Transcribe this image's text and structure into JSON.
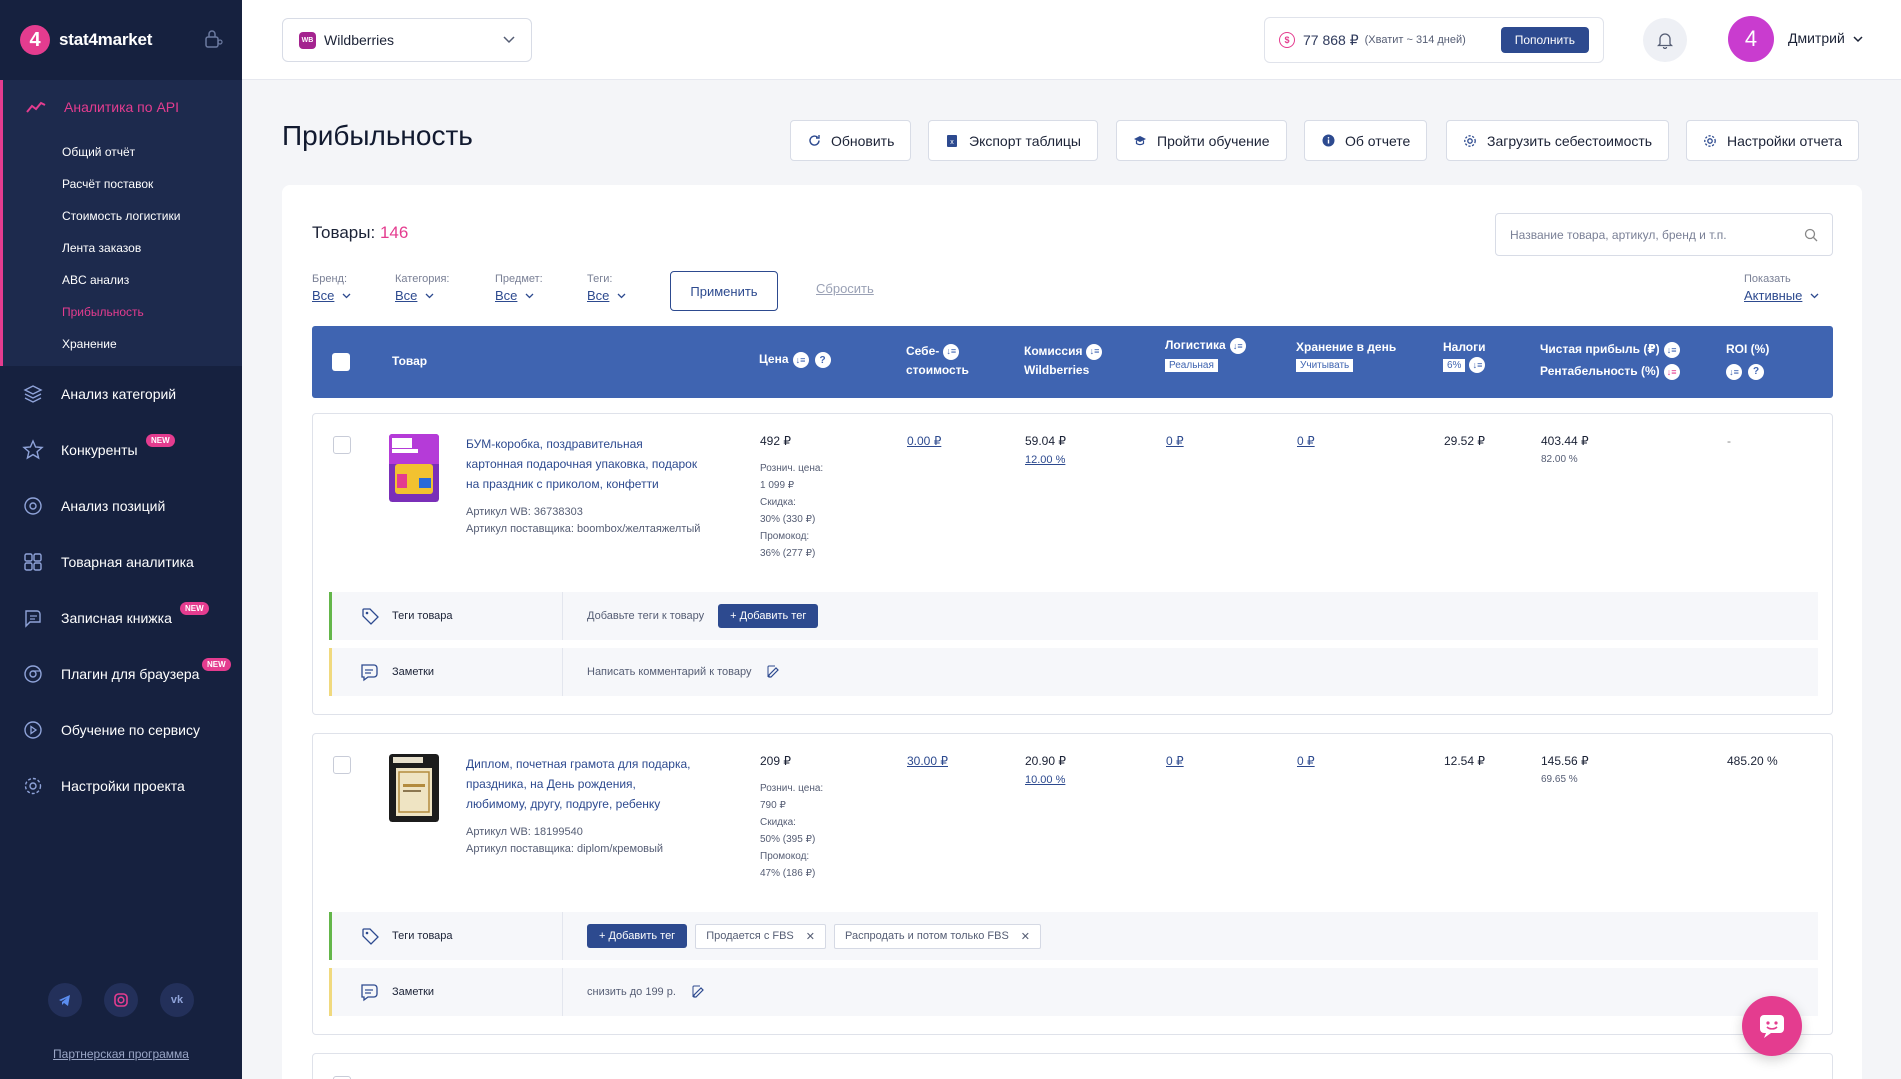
{
  "app": {
    "logo_glyph": "4",
    "logo_text": "stat4market"
  },
  "sidebar": {
    "section_title": "Аналитика по API",
    "sub_items": [
      {
        "label": "Общий отчёт",
        "active": false
      },
      {
        "label": "Расчёт поставок",
        "active": false
      },
      {
        "label": "Стоимость логистики",
        "active": false
      },
      {
        "label": "Лента заказов",
        "active": false
      },
      {
        "label": "ABC анализ",
        "active": false
      },
      {
        "label": "Прибыльность",
        "active": true
      },
      {
        "label": "Хранение",
        "active": false
      }
    ],
    "nav_items": [
      {
        "label": "Анализ категорий",
        "icon": "layers-icon",
        "badge": ""
      },
      {
        "label": "Конкуренты",
        "icon": "star-icon",
        "badge": "NEW"
      },
      {
        "label": "Анализ позиций",
        "icon": "target-icon",
        "badge": ""
      },
      {
        "label": "Товарная аналитика",
        "icon": "grid-icon",
        "badge": ""
      },
      {
        "label": "Записная книжка",
        "icon": "notebook-icon",
        "badge": "NEW"
      },
      {
        "label": "Плагин для браузера",
        "icon": "chrome-icon",
        "badge": "NEW"
      },
      {
        "label": "Обучение по сервису",
        "icon": "play-icon",
        "badge": ""
      },
      {
        "label": "Настройки проекта",
        "icon": "gear-icon",
        "badge": ""
      }
    ],
    "socials": [
      "telegram-icon",
      "instagram-icon",
      "vk-icon"
    ],
    "partner_link": "Партнерская программа"
  },
  "topbar": {
    "marketplace": {
      "badge": "WB",
      "label": "Wildberries"
    },
    "balance": {
      "amount": "77 868 ₽",
      "note": "(Хватит ~ 314 дней)",
      "topup_label": "Пополнить"
    },
    "avatar_letter": "4",
    "username": "Дмитрий"
  },
  "page": {
    "title": "Прибыльность",
    "actions": {
      "refresh": "Обновить",
      "export": "Экспорт таблицы",
      "tutorial": "Пройти обучение",
      "about": "Об отчете",
      "upload_cost": "Загрузить себестоимость",
      "settings": "Настройки отчета"
    }
  },
  "products": {
    "count_label": "Товары:",
    "count": "146",
    "search_placeholder": "Название товара, артикул, бренд и т.п."
  },
  "filters": {
    "brand": {
      "label": "Бренд:",
      "value": "Все"
    },
    "category": {
      "label": "Категория:",
      "value": "Все"
    },
    "subject": {
      "label": "Предмет:",
      "value": "Все"
    },
    "tags": {
      "label": "Теги:",
      "value": "Все"
    },
    "apply": "Применить",
    "reset": "Сбросить",
    "show": {
      "label": "Показать",
      "value": "Активные"
    }
  },
  "table": {
    "headers": {
      "product": "Товар",
      "price": "Цена",
      "cost_1": "Себе-",
      "cost_2": "стоимость",
      "commission_1": "Комиссия",
      "commission_2": "Wildberries",
      "logistics": "Логистика",
      "logistics_tag": "Реальная",
      "storage": "Хранение в день",
      "storage_tag": "Учитывать",
      "taxes": "Налоги",
      "taxes_tag": "6%",
      "profit": "Чистая прибыль (₽)",
      "margin": "Рентабельность (%)",
      "roi": "ROI (%)"
    },
    "tags_label": "Теги товара",
    "notes_label": "Заметки",
    "rows": [
      {
        "name": "БУМ-коробка, поздравительная картонная подарочная упаковка, подарок на праздник с приколом, конфетти",
        "article_wb": "Артикул WB: 36738303",
        "article_supplier": "Артикул поставщика: boombox/желтаяжелтый",
        "price": "492 ₽",
        "retail_label": "Рознич. цена:",
        "retail": "1 099 ₽",
        "discount_label": "Скидка:",
        "discount": "30% (330 ₽)",
        "promo_label": "Промокод:",
        "promo": "36% (277 ₽)",
        "cost": "0.00 ₽",
        "commission": "59.04 ₽",
        "commission_pct": "12.00 %",
        "logistics": "0 ₽",
        "storage": "0 ₽",
        "taxes": "29.52 ₽",
        "profit": "403.44 ₽",
        "margin": "82.00 %",
        "roi": "-",
        "tags_placeholder": "Добавьте теги к товару",
        "add_tag": "+ Добавить тег",
        "tags": [],
        "note": "Написать комментарий к товару"
      },
      {
        "name": "Диплом, почетная грамота для подарка, праздника, на День рождения, любимому, другу, подруге, ребенку",
        "article_wb": "Артикул WB: 18199540",
        "article_supplier": "Артикул поставщика: diplom/кремовый",
        "price": "209 ₽",
        "retail_label": "Рознич. цена:",
        "retail": "790 ₽",
        "discount_label": "Скидка:",
        "discount": "50% (395 ₽)",
        "promo_label": "Промокод:",
        "promo": "47% (186 ₽)",
        "cost": "30.00 ₽",
        "commission": "20.90 ₽",
        "commission_pct": "10.00 %",
        "logistics": "0 ₽",
        "storage": "0 ₽",
        "taxes": "12.54 ₽",
        "profit": "145.56 ₽",
        "margin": "69.65 %",
        "roi": "485.20 %",
        "add_tag": "+ Добавить тег",
        "tags": [
          "Продается с FBS",
          "Распродать и потом только FBS"
        ],
        "note": "снизить до 199 р."
      }
    ]
  },
  "colors": {
    "accent": "#e43c8f",
    "primary": "#2d4a8f",
    "header_blue": "#3f64b1",
    "sidebar": "#16213f"
  }
}
